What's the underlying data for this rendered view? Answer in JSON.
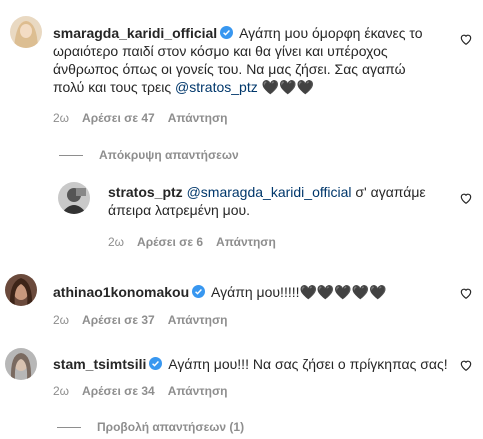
{
  "comments": [
    {
      "username": "smaragda_karidi_official",
      "text_line1": "Αγάπη μου όμορφη έκανες το",
      "text_line2": "ωραιότερο παιδί στον κόσμο και θα γίνει και υπέροχος",
      "text_line3": "άνθρωπος όπως οι γονείς του. Να μας ζήσει. Σας αγαπώ",
      "text_line4_pre": "πολύ και τους τρεις",
      "mention": "@stratos_ptz",
      "text_line4_post": "🖤🖤🖤",
      "age": "2ω",
      "likes": "Αρέσει σε 47",
      "reply": "Απάντηση"
    },
    {
      "username": "stratos_ptz",
      "mention": "@smaragda_karidi_official",
      "text_line1_post": "σ' αγαπάμε",
      "text_line2": "άπειρα λατρεμένη μου.",
      "age": "2ω",
      "likes": "Αρέσει σε 6",
      "reply": "Απάντηση"
    },
    {
      "username": "athinao1konomakou",
      "text": "Αγάπη μου!!!!!🖤🖤🖤🖤🖤",
      "age": "2ω",
      "likes": "Αρέσει σε 37",
      "reply": "Απάντηση"
    },
    {
      "username": "stam_tsimtsili",
      "text": "Αγάπη μου!!! Να σας ζήσει ο πρίγκηπας σας!",
      "age": "2ω",
      "likes": "Αρέσει σε 34",
      "reply": "Απάντηση"
    }
  ],
  "hide_replies": "Απόκρυψη απαντήσεων",
  "view_replies": "Προβολή απαντήσεων (1)",
  "icons": {
    "verified": "verified-badge-icon",
    "like": "heart-outline-icon"
  },
  "colors": {
    "verified_blue": "#3897f0",
    "mention": "#00376b",
    "meta_gray": "#8e8e8e"
  }
}
